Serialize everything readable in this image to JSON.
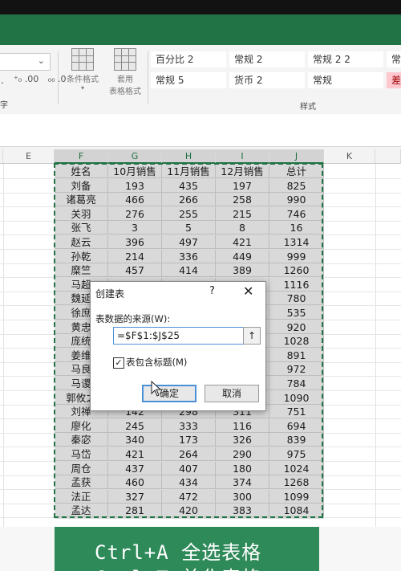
{
  "ribbon": {
    "number_buttons": [
      "¸",
      "⁺₀ .00",
      "₀₀ .0"
    ],
    "cond_format_label": "条件格式",
    "table_format_label_1": "套用",
    "table_format_label_2": "表格格式",
    "left_group_label": "字",
    "styles_group_label": "样式",
    "style_cells": [
      [
        "百分比 2",
        "常规 2",
        "常规 2 2",
        "常"
      ],
      [
        "常规 5",
        "货币 2",
        "常规",
        "差"
      ]
    ]
  },
  "sheet": {
    "column_headers": [
      "E",
      "F",
      "G",
      "H",
      "I",
      "J",
      "K"
    ],
    "rows": [
      [
        "姓名",
        "10月销售",
        "11月销售",
        "12月销售",
        "总计"
      ],
      [
        "刘备",
        "193",
        "435",
        "197",
        "825"
      ],
      [
        "诸葛亮",
        "466",
        "266",
        "258",
        "990"
      ],
      [
        "关羽",
        "276",
        "255",
        "215",
        "746"
      ],
      [
        "张飞",
        "3",
        "5",
        "8",
        "16"
      ],
      [
        "赵云",
        "396",
        "497",
        "421",
        "1314"
      ],
      [
        "孙乾",
        "214",
        "336",
        "449",
        "999"
      ],
      [
        "糜竺",
        "457",
        "414",
        "389",
        "1260"
      ],
      [
        "马超",
        "",
        "",
        "",
        "1116"
      ],
      [
        "魏延",
        "",
        "",
        "",
        "780"
      ],
      [
        "徐庶",
        "",
        "",
        "",
        "535"
      ],
      [
        "黄忠",
        "",
        "",
        "",
        "920"
      ],
      [
        "庞统",
        "",
        "",
        "",
        "1028"
      ],
      [
        "姜维",
        "",
        "",
        "",
        "891"
      ],
      [
        "马良",
        "",
        "",
        "",
        "972"
      ],
      [
        "马谡",
        "",
        "",
        "",
        "784"
      ],
      [
        "郭攸之",
        "",
        "",
        "",
        "1090"
      ],
      [
        "刘禅",
        "142",
        "298",
        "311",
        "751"
      ],
      [
        "廖化",
        "245",
        "333",
        "116",
        "694"
      ],
      [
        "秦宓",
        "340",
        "173",
        "326",
        "839"
      ],
      [
        "马岱",
        "421",
        "264",
        "290",
        "975"
      ],
      [
        "周仓",
        "437",
        "407",
        "180",
        "1024"
      ],
      [
        "孟获",
        "460",
        "434",
        "374",
        "1268"
      ],
      [
        "法正",
        "327",
        "472",
        "300",
        "1099"
      ],
      [
        "孟达",
        "281",
        "420",
        "383",
        "1084"
      ]
    ]
  },
  "dialog": {
    "title": "创建表",
    "help": "?",
    "close": "✕",
    "source_label": "表数据的来源(W):",
    "range_value": "=$F$1:$J$25",
    "collapse_icon": "↑",
    "has_headers_label": "表包含标题(M)",
    "has_headers_checked": true,
    "check_mark": "✓",
    "ok_label": "确定",
    "cancel_label": "取消"
  },
  "caption": {
    "line1": "Ctrl+A 全选表格",
    "line2": "Ctrl+T 美化表格"
  }
}
